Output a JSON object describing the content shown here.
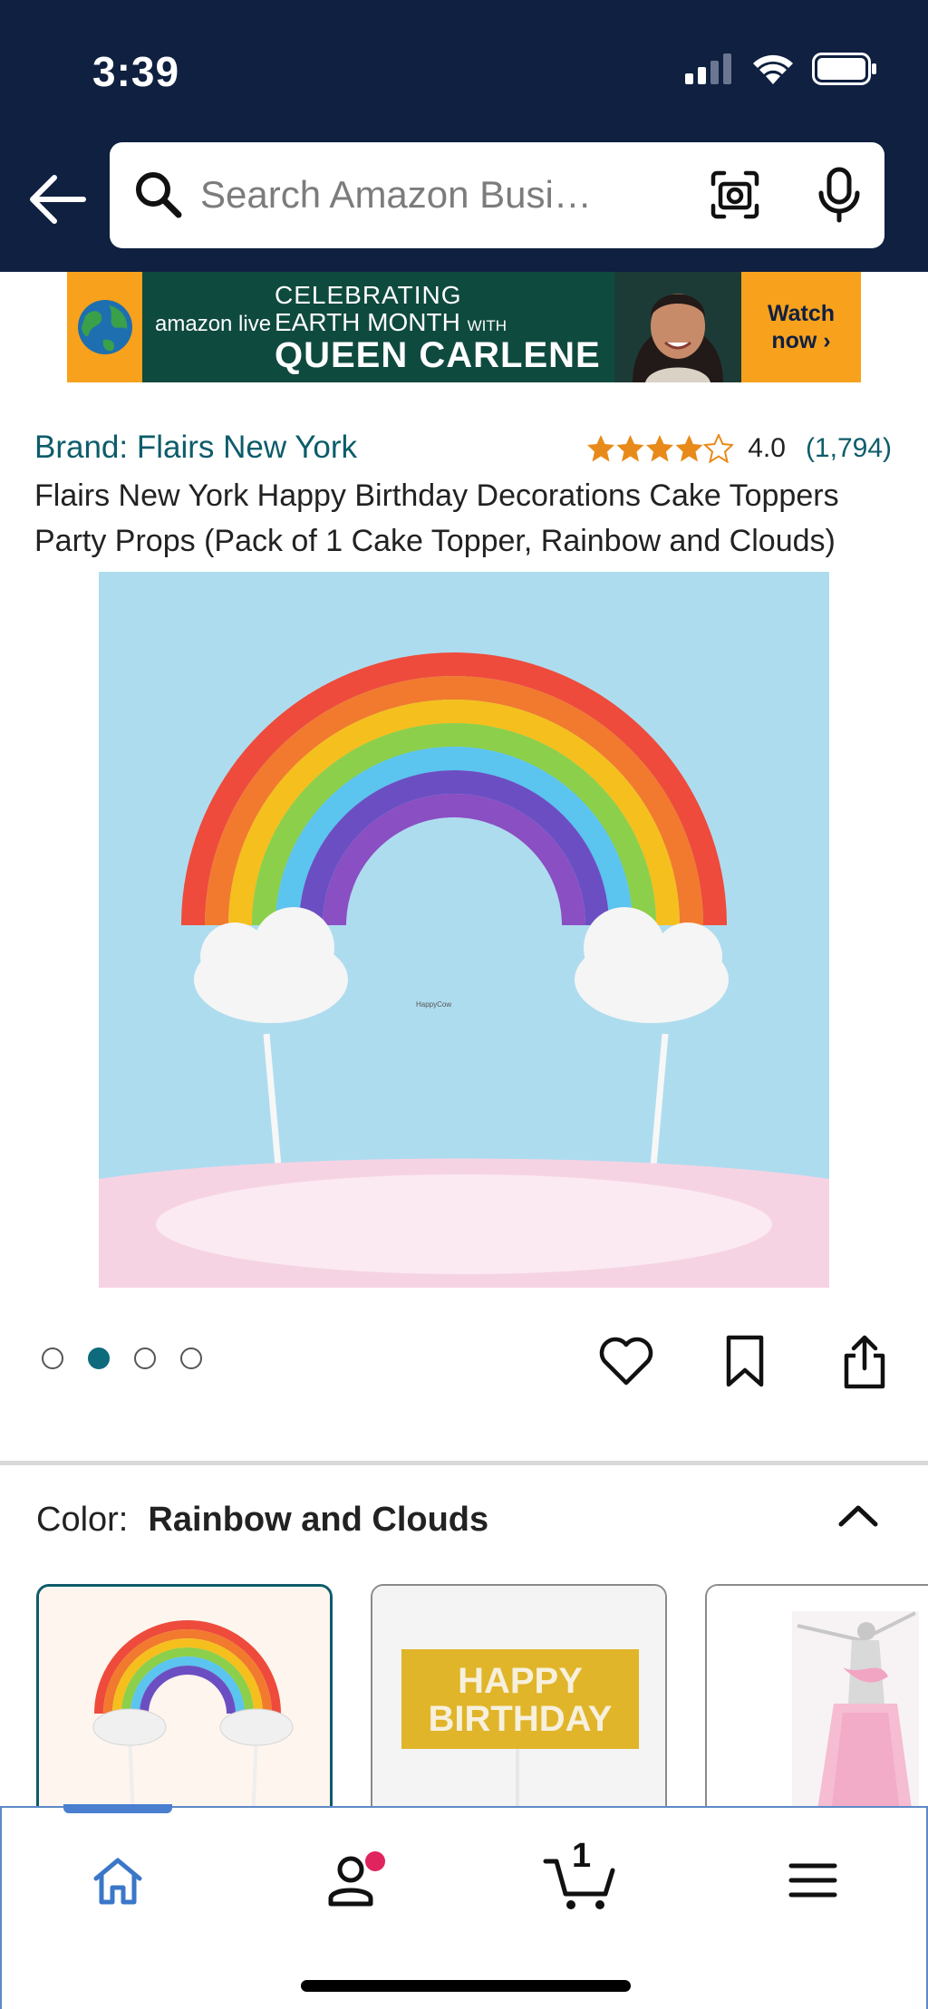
{
  "status": {
    "time": "3:39"
  },
  "search": {
    "placeholder": "Search Amazon Busi…"
  },
  "banner": {
    "logo": "amazon live",
    "line1": "CELEBRATING",
    "line2": "EARTH MONTH",
    "line2_small": "WITH",
    "line3": "QUEEN CARLENE",
    "cta_line1": "Watch",
    "cta_line2": "now ›"
  },
  "product": {
    "brand": "Brand: Flairs New York",
    "rating_value": "4.0",
    "rating_stars": 4.0,
    "rating_count": "(1,794)",
    "title": "Flairs New York Happy Birthday Decorations Cake Toppers Party Props (Pack of 1 Cake Topper, Rainbow and Clouds)",
    "image_watermark": "HappyCow"
  },
  "gallery": {
    "total_images": 4,
    "active_index": 1
  },
  "color": {
    "label": "Color:",
    "selected": "Rainbow and Clouds",
    "options": [
      {
        "name": "Rainbow and Clouds",
        "selected": true
      },
      {
        "name": "HAPPY BIRTHDAY",
        "line1": "HAPPY",
        "line2": "BIRTHDAY",
        "selected": false
      },
      {
        "name": "Ballerina",
        "selected": false
      }
    ]
  },
  "nav": {
    "cart_count": "1"
  },
  "colors": {
    "header": "#0f2040",
    "link": "#0d5c6b",
    "star": "#e88a1a",
    "accent": "#f7a11d",
    "nav_border": "#5d89c7"
  }
}
